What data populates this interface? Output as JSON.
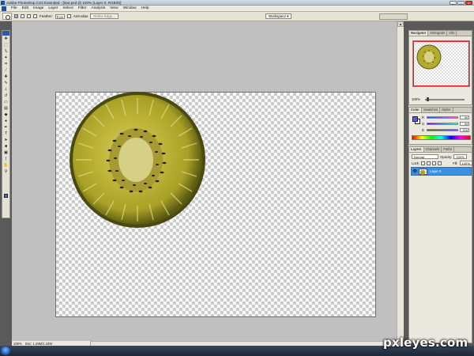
{
  "window": {
    "title": "Adobe Photoshop CS3 Extended - [kiwi.psd @ 100% (Layer 0, RGB/8)]"
  },
  "menu": [
    "File",
    "Edit",
    "Image",
    "Layer",
    "Select",
    "Filter",
    "Analysis",
    "View",
    "Window",
    "Help"
  ],
  "options": {
    "feather_label": "Feather:",
    "feather_value": "0 px",
    "antialias_label": "Anti-alias",
    "refine_label": "Refine Edge...",
    "workspace_label": "Workspace ▾"
  },
  "window_buttons": {
    "minimize": "_",
    "maximize": "□",
    "close": "x"
  },
  "status": {
    "zoom": "100%",
    "doc": "Doc: 1.29M/1.44M"
  },
  "navigator": {
    "tabs": [
      "Navigator",
      "Histogram",
      "Info"
    ],
    "zoom": "100%"
  },
  "color": {
    "tabs": [
      "Color",
      "Swatches",
      "Styles"
    ],
    "rows": [
      {
        "label": "R",
        "value": "90"
      },
      {
        "label": "G",
        "value": "93"
      },
      {
        "label": "B",
        "value": "216"
      }
    ],
    "fg": "#5a5dd8"
  },
  "layers": {
    "tabs": [
      "Layers",
      "Channels",
      "Paths"
    ],
    "blend": "Normal",
    "opacity_label": "Opacity:",
    "opacity_value": "100%",
    "lock_label": "Lock:",
    "fill_label": "Fill:",
    "fill_value": "100%",
    "layer_name": "Layer 0",
    "eye": "👁"
  },
  "watermark": "pxleyes.com"
}
